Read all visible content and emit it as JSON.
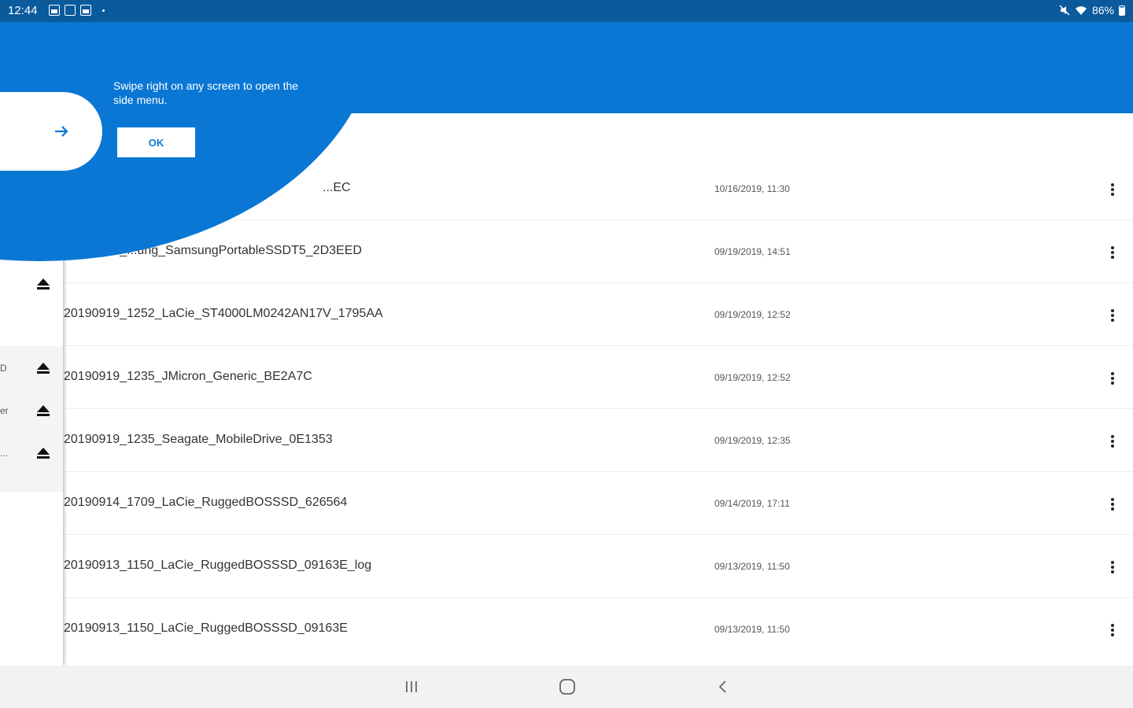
{
  "status_bar": {
    "time": "12:44",
    "battery": "86%",
    "left_icons": [
      "gallery-icon",
      "calendar-icon",
      "photo-icon"
    ],
    "right_icons": [
      "mute-icon",
      "wifi-icon",
      "battery-icon"
    ]
  },
  "toolbar": {
    "actions": [
      "grid-view-icon",
      "select-icon",
      "more-options-icon"
    ],
    "color": "#0a77d4"
  },
  "coach_mark": {
    "text": "Swipe right on any screen to open the side menu.",
    "ok_label": "OK",
    "icon": "arrow-right-icon"
  },
  "drawer": {
    "eject_icon": "eject-icon",
    "partial_labels": [
      "D",
      "er",
      "..."
    ]
  },
  "files": [
    {
      "name": "...EC",
      "date": "10/16/2019, 11:30"
    },
    {
      "name": "20190919_...ung_SamsungPortableSSDT5_2D3EED",
      "date": "09/19/2019, 14:51"
    },
    {
      "name": "20190919_1252_LaCie_ST4000LM0242AN17V_1795AA",
      "date": "09/19/2019, 12:52"
    },
    {
      "name": "20190919_1235_JMicron_Generic_BE2A7C",
      "date": "09/19/2019, 12:52"
    },
    {
      "name": "20190919_1235_Seagate_MobileDrive_0E1353",
      "date": "09/19/2019, 12:35"
    },
    {
      "name": "20190914_1709_LaCie_RuggedBOSSSD_626564",
      "date": "09/14/2019, 17:11"
    },
    {
      "name": "20190913_1150_LaCie_RuggedBOSSSD_09163E_log",
      "date": "09/13/2019, 11:50"
    },
    {
      "name": "20190913_1150_LaCie_RuggedBOSSSD_09163E",
      "date": "09/13/2019, 11:50"
    }
  ],
  "nav": {
    "recents": "recents-icon",
    "home": "home-icon",
    "back": "back-icon"
  }
}
